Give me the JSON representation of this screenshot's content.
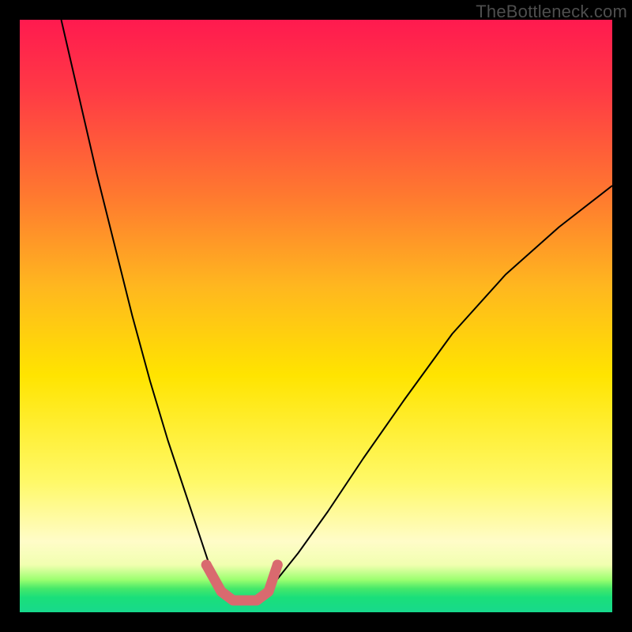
{
  "watermark": "TheBottleneck.com",
  "gradient": {
    "top": "#ff1a4f",
    "mid_upper": "#ff7a2f",
    "mid": "#ffe400",
    "mid_lower": "#fffcc8",
    "bottom": "#17d98c"
  },
  "chart_data": {
    "type": "line",
    "title": "",
    "xlabel": "",
    "ylabel": "",
    "xlim": [
      0,
      100
    ],
    "ylim": [
      0,
      100
    ],
    "notes": "Bottleneck-style V-curve. Y-axis inverted visually (0 = bottom/green/good, 100 = top/red/bad). Two thin black curves form a V meeting near x≈36–40 at y≈2. A short pink/red thick segment with endpoint dots marks the trough between x≈32 and x≈43.",
    "series": [
      {
        "name": "left-branch",
        "color": "#000000",
        "stroke_width": 2,
        "x": [
          7,
          10,
          13,
          16,
          19,
          22,
          25,
          28,
          30,
          32,
          34,
          36
        ],
        "y": [
          100,
          87,
          74,
          62,
          50,
          39,
          29,
          20,
          14,
          8,
          4,
          2
        ]
      },
      {
        "name": "right-branch",
        "color": "#000000",
        "stroke_width": 2,
        "x": [
          40,
          43,
          47,
          52,
          58,
          65,
          73,
          82,
          91,
          100
        ],
        "y": [
          2,
          5,
          10,
          17,
          26,
          36,
          47,
          57,
          65,
          72
        ]
      },
      {
        "name": "trough-marker",
        "color": "#d96a6f",
        "stroke_width": 13,
        "linecap": "round",
        "endpoints_as_dots": true,
        "x": [
          31.5,
          34,
          36,
          38,
          40,
          42,
          43.5
        ],
        "y": [
          8,
          3.5,
          2,
          2,
          2,
          3.5,
          8
        ]
      }
    ]
  }
}
